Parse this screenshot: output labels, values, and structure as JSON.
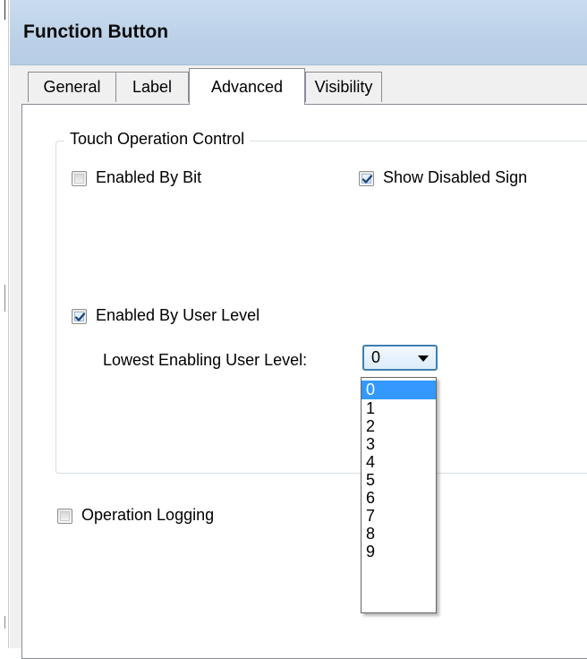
{
  "window": {
    "title": "Function Button"
  },
  "tabs": [
    {
      "label": "General",
      "active": false
    },
    {
      "label": "Label",
      "active": false
    },
    {
      "label": "Advanced",
      "active": true
    },
    {
      "label": "Visibility",
      "active": false
    }
  ],
  "touch_group": {
    "legend": "Touch Operation Control",
    "enabled_by_bit": {
      "label": "Enabled By Bit",
      "checked": false
    },
    "show_disabled_sign": {
      "label": "Show Disabled Sign",
      "checked": true
    },
    "enabled_by_user_level": {
      "label": "Enabled By User Level",
      "checked": true
    },
    "lowest_level_label": "Lowest Enabling User Level:",
    "lowest_level_select": {
      "value": "0",
      "options": [
        "0",
        "1",
        "2",
        "3",
        "4",
        "5",
        "6",
        "7",
        "8",
        "9"
      ],
      "selected_index": 0
    }
  },
  "operation_logging": {
    "label": "Operation Logging",
    "checked": false
  },
  "colors": {
    "titlebar": "#bcd1e8",
    "selection": "#3399ff",
    "select_border": "#3c7fb1"
  }
}
